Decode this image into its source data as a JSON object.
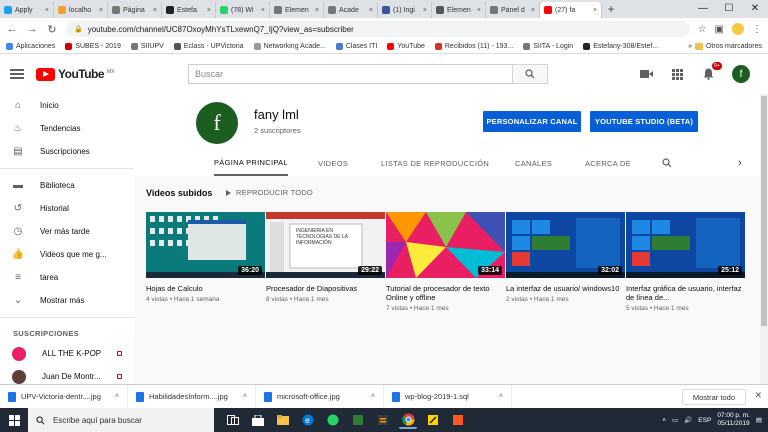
{
  "browser": {
    "tabs": [
      {
        "label": "Apply",
        "color": "#1da1f2"
      },
      {
        "label": "localho",
        "color": "#f0a030"
      },
      {
        "label": "Página",
        "color": "#777777"
      },
      {
        "label": "Estefa",
        "color": "#222222"
      },
      {
        "label": "(78) Wi",
        "color": "#25d366"
      },
      {
        "label": "Elemen",
        "color": "#777777"
      },
      {
        "label": "Acade",
        "color": "#777777"
      },
      {
        "label": "(1) Ingi",
        "color": "#3b5998"
      },
      {
        "label": "Elemen",
        "color": "#555555"
      },
      {
        "label": "Panel d",
        "color": "#777777"
      },
      {
        "label": "(27) fa",
        "color": "#ff0000",
        "active": true
      }
    ],
    "new_tab": "+",
    "window_controls": {
      "minimize": "—",
      "maximize": "☐",
      "close": "✕"
    },
    "url": "youtube.com/channel/UC87OxoyMhYsTLxewnQ7_IjQ?view_as=subscriber",
    "bookmarks": [
      {
        "label": "Aplicaciones",
        "color": "#4285f4"
      },
      {
        "label": "SUBES - 2019",
        "color": "#cc0000"
      },
      {
        "label": "SIIUPV",
        "color": "#777777"
      },
      {
        "label": "Eclass - UPVictoria",
        "color": "#555555"
      },
      {
        "label": "Networking Acade...",
        "color": "#999999"
      },
      {
        "label": "Clases ITI",
        "color": "#4a7bd0"
      },
      {
        "label": "YouTube",
        "color": "#ff0000"
      },
      {
        "label": "Recibidos (11) - 193...",
        "color": "#d93025"
      },
      {
        "label": "SIITA - Login",
        "color": "#777777"
      },
      {
        "label": "Estefany-308/Estef...",
        "color": "#222222"
      }
    ],
    "bookmarks_more": "»",
    "other_bookmarks": "Otros marcadores"
  },
  "header": {
    "logo_text": "YouTube",
    "logo_region": "MX",
    "search_placeholder": "Buscar",
    "notification_count": "9+",
    "user_initial": "f"
  },
  "sidebar": {
    "items": [
      {
        "label": "Inicio",
        "icon": "home-icon"
      },
      {
        "label": "Tendencias",
        "icon": "flame-icon"
      },
      {
        "label": "Suscripciones",
        "icon": "subscriptions-icon"
      }
    ],
    "library_items": [
      {
        "label": "Biblioteca",
        "icon": "folder-icon"
      },
      {
        "label": "Historial",
        "icon": "history-icon"
      },
      {
        "label": "Ver más tarde",
        "icon": "clock-icon"
      },
      {
        "label": "Videos que me g...",
        "icon": "thumbs-up-icon"
      },
      {
        "label": "tarea",
        "icon": "playlist-icon"
      },
      {
        "label": "Mostrar más",
        "icon": "chevron-down-icon"
      }
    ],
    "subscriptions_heading": "SUSCRIPCIONES",
    "subscriptions": [
      {
        "label": "ALL THE K-POP",
        "color": "#e91e63"
      },
      {
        "label": "Juan De Montr...",
        "color": "#5d4037"
      }
    ]
  },
  "channel": {
    "initial": "f",
    "name": "fany lml",
    "subscribers": "2 suscriptores",
    "customize_button": "PERSONALIZAR CANAL",
    "studio_button": "YOUTUBE STUDIO (BETA)",
    "tabs": [
      "PÁGINA PRINCIPAL",
      "VIDEOS",
      "LISTAS DE REPRODUCCIÓN",
      "CANALES",
      "ACERCA DE"
    ]
  },
  "content": {
    "section_title": "Videos subidos",
    "play_all": "REPRODUCIR TODO",
    "videos": [
      {
        "title": "Hojas de Calculo",
        "meta": "4 vistas • Hace 1 semana",
        "duration": "36:20"
      },
      {
        "title": "Procesador de Diapositivas",
        "meta": "8 vistas • Hace 1 mes",
        "duration": "29:22",
        "thumb_text": "INGENIERÍA EN TECNOLOGÍAS DE LA INFORMACIÓN"
      },
      {
        "title": "Tutorial de procesador de texto Online y offline",
        "meta": "7 vistas • Hace 1 mes",
        "duration": "33:14"
      },
      {
        "title": "La interfaz de usuario/ windows10",
        "meta": "2 vistas • Hace 1 mes",
        "duration": "32:02"
      },
      {
        "title": "Interfaz gráfica de usuario, interfaz de línea de...",
        "meta": "5 vistas • Hace 1 mes",
        "duration": "25:12"
      }
    ]
  },
  "downloads": {
    "items": [
      "UPV-Victoria-dentr....jpg",
      "HabilidadesInform....jpg",
      "microsoft-office.jpg",
      "wp-blog-2019-1.sql"
    ],
    "show_all": "Mostrar todo",
    "close": "✕"
  },
  "taskbar": {
    "search_placeholder": "Escribe aquí para buscar",
    "language": "ESP",
    "time": "07:00 p. m.",
    "date": "05/11/2019"
  }
}
